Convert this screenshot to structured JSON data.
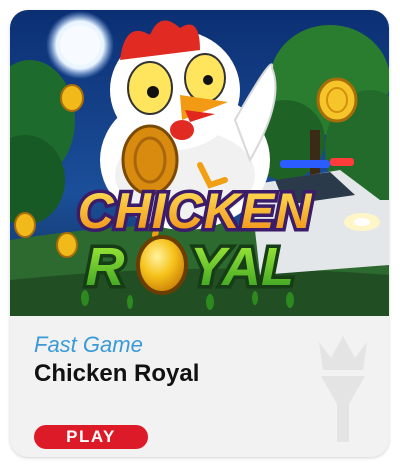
{
  "game_card": {
    "category": "Fast Game",
    "title": "Chicken Royal",
    "play_label": "PLAY",
    "thumbnail": {
      "logo_line1": "CHICKEN",
      "logo_line2_left": "R",
      "logo_line2_right": "YAL",
      "icon": "chicken-royal-art"
    },
    "watermark_icon": "crown-y-icon"
  },
  "colors": {
    "category_text": "#3a9ad9",
    "play_button": "#dd1b28",
    "card_background": "#f2f2f2"
  }
}
